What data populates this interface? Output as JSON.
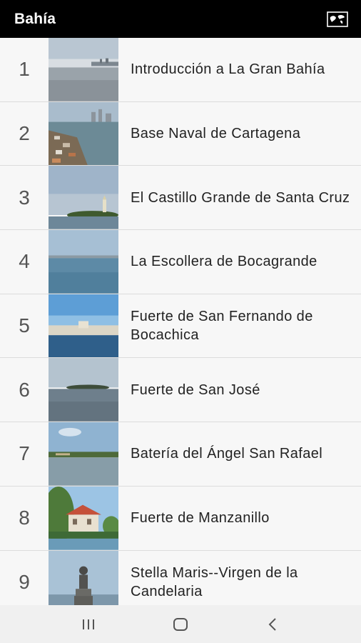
{
  "app": {
    "title": "Bahía",
    "map_icon": "map-icon"
  },
  "items": [
    {
      "num": "1",
      "label": "Introducción a La Gran Bahía"
    },
    {
      "num": "2",
      "label": "Base Naval de Cartagena"
    },
    {
      "num": "3",
      "label": "El Castillo Grande de Santa Cruz"
    },
    {
      "num": "4",
      "label": "La Escollera de Bocagrande"
    },
    {
      "num": "5",
      "label": "Fuerte de San Fernando de Bocachica"
    },
    {
      "num": "6",
      "label": "Fuerte de San José"
    },
    {
      "num": "7",
      "label": "Batería del Ángel San Rafael"
    },
    {
      "num": "8",
      "label": "Fuerte de Manzanillo"
    },
    {
      "num": "9",
      "label": "Stella Maris--Virgen de la Candelaria"
    }
  ],
  "navbar": {
    "recents_icon": "recents-icon",
    "home_icon": "home-icon",
    "back_icon": "back-icon"
  }
}
